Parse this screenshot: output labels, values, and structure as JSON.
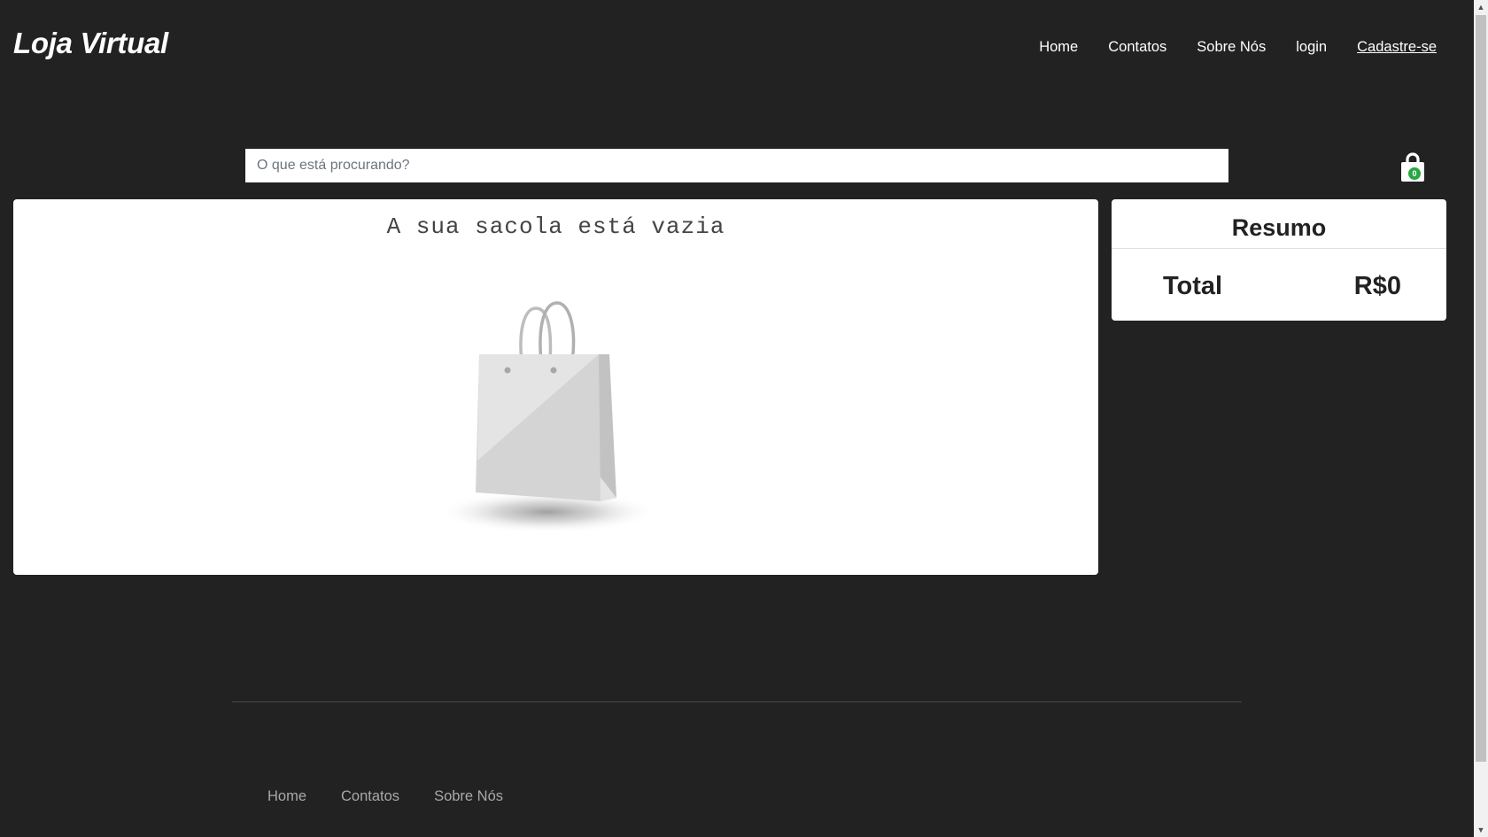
{
  "header": {
    "brand": "Loja Virtual",
    "nav": [
      "Home",
      "Contatos",
      "Sobre Nós",
      "login",
      "Cadastre-se"
    ]
  },
  "search": {
    "placeholder": "O que está procurando?",
    "value": ""
  },
  "cart_icon": {
    "icon": "shopping-bag-icon",
    "count": "0",
    "badge_color": "#28a745"
  },
  "cart": {
    "empty_message": "A sua sacola está vazia",
    "illustration": "empty-bag-illustration"
  },
  "summary": {
    "title": "Resumo",
    "total_label": "Total",
    "total_value": "R$0"
  },
  "footer": {
    "nav": [
      "Home",
      "Contatos",
      "Sobre Nós"
    ]
  },
  "colors": {
    "background": "#222222",
    "card": "#ffffff",
    "footer_link": "#a9a9a9"
  }
}
